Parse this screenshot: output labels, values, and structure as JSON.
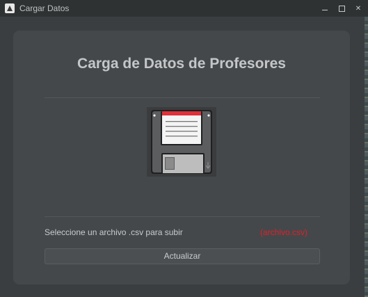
{
  "window": {
    "title": "Cargar Datos"
  },
  "panel": {
    "heading": "Carga de Datos de Profesores",
    "instruction": "Seleccione un archivo .csv para subir",
    "file_label": "(archivo.csv)",
    "update_button_label": "Actualizar"
  },
  "icons": {
    "app": "app-icon",
    "minimize": "minimize-icon",
    "maximize": "maximize-icon",
    "close": "close-icon",
    "floppy": "floppy-disk-icon"
  },
  "colors": {
    "background": "#3b3e40",
    "panel": "#45484a",
    "title_text": "#c4c6c8",
    "file_label": "#e0202a",
    "floppy_body": "#5a5c5e",
    "floppy_label_stripe": "#e0303a"
  }
}
